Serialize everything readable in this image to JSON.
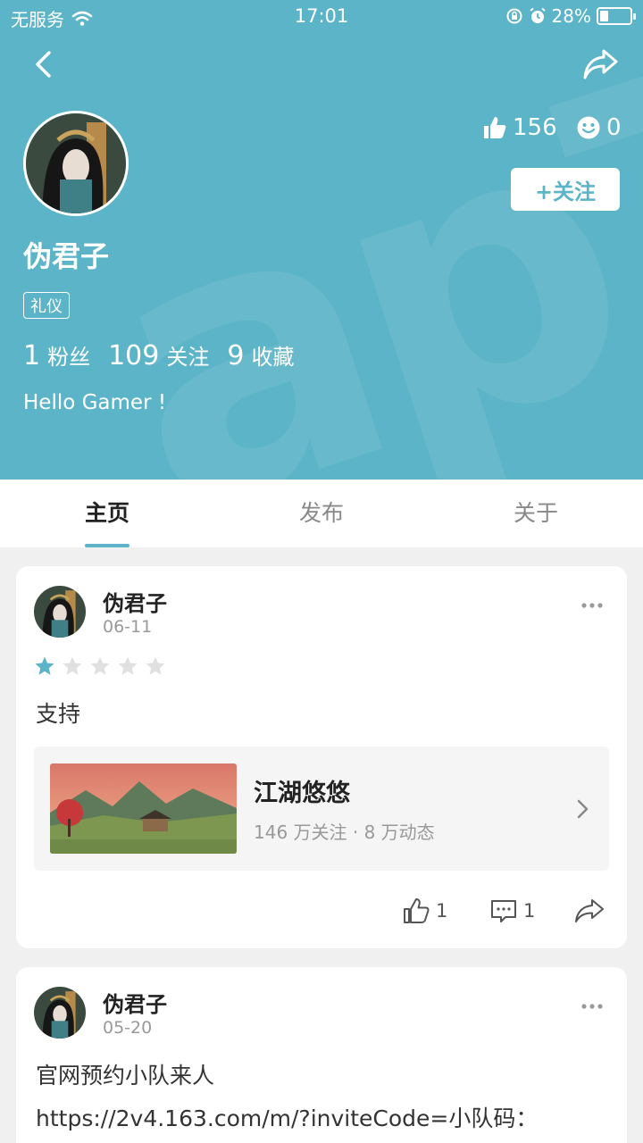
{
  "status_bar": {
    "carrier": "无服务",
    "time": "17:01",
    "battery": "28%"
  },
  "profile": {
    "name": "伪君子",
    "tag": "礼仪",
    "likes": "156",
    "mood_count": "0",
    "follow_label": "+关注",
    "stats": [
      {
        "value": "1",
        "label": "粉丝"
      },
      {
        "value": "109",
        "label": "关注"
      },
      {
        "value": "9",
        "label": "收藏"
      }
    ],
    "bio": "Hello Gamer !"
  },
  "tabs": [
    "主页",
    "发布",
    "关于"
  ],
  "posts": [
    {
      "author": "伪君子",
      "date": "06-11",
      "rating": 1,
      "rating_max": 5,
      "text": "支持",
      "game": {
        "name": "江湖悠悠",
        "meta": "146 万关注 · 8 万动态"
      },
      "likes": "1",
      "comments": "1"
    },
    {
      "author": "伪君子",
      "date": "05-20",
      "text_line1": "官网预约小队来人",
      "text_line2": "https://2v4.163.com/m/?inviteCode=小队码："
    }
  ],
  "colors": {
    "accent": "#5bb4c7",
    "star_on": "#5bb4c7",
    "star_off": "#e0e0e0"
  }
}
